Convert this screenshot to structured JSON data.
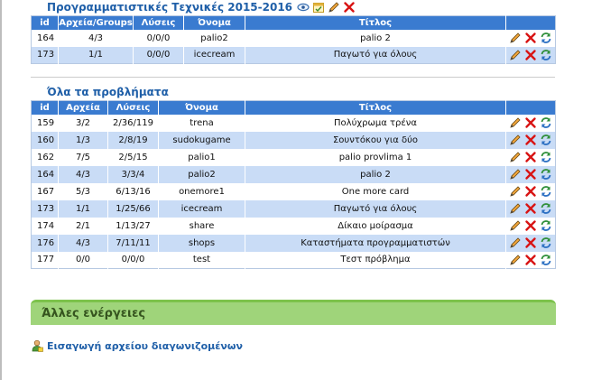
{
  "contest": {
    "title": "Προγραμματιστικές Τεχνικές 2015-2016",
    "columns": [
      "id",
      "Αρχεία/Groups",
      "Λύσεις",
      "Όνομα",
      "Τίτλος",
      ""
    ],
    "rows": [
      {
        "id": "164",
        "files": "4/3",
        "solutions": "0/0/0",
        "name": "palio2",
        "title": "palio 2"
      },
      {
        "id": "173",
        "files": "1/1",
        "solutions": "0/0/0",
        "name": "icecream",
        "title": "Παγωτό για όλους"
      }
    ]
  },
  "problems": {
    "title": "Όλα τα προβλήματα",
    "columns": [
      "id",
      "Αρχεία",
      "Λύσεις",
      "Όνομα",
      "Τίτλος",
      ""
    ],
    "rows": [
      {
        "id": "159",
        "files": "3/2",
        "solutions": "2/36/119",
        "name": "trena",
        "title": "Πολύχρωμα τρένα"
      },
      {
        "id": "160",
        "files": "1/3",
        "solutions": "2/8/19",
        "name": "sudokugame",
        "title": "Σουντόκου για δύο"
      },
      {
        "id": "162",
        "files": "7/5",
        "solutions": "2/5/15",
        "name": "palio1",
        "title": "palio provlima 1"
      },
      {
        "id": "164",
        "files": "4/3",
        "solutions": "3/3/4",
        "name": "palio2",
        "title": "palio 2"
      },
      {
        "id": "167",
        "files": "5/3",
        "solutions": "6/13/16",
        "name": "onemore1",
        "title": "One more card"
      },
      {
        "id": "173",
        "files": "1/1",
        "solutions": "1/25/66",
        "name": "icecream",
        "title": "Παγωτό για όλους"
      },
      {
        "id": "174",
        "files": "2/1",
        "solutions": "1/13/27",
        "name": "share",
        "title": "Δίκαιο μοίρασμα"
      },
      {
        "id": "176",
        "files": "4/3",
        "solutions": "7/11/11",
        "name": "shops",
        "title": "Καταστήματα προγραμματιστών"
      },
      {
        "id": "177",
        "files": "0/0",
        "solutions": "0/0/0",
        "name": "test",
        "title": "Τεστ πρόβλημα"
      }
    ]
  },
  "other_actions": {
    "heading": "Άλλες ενέργειες",
    "import_label": "Εισαγωγή αρχείου διαγωνιζομένων"
  },
  "colors": {
    "header_blue": "#3a7bd0",
    "row_alt": "#c9dcf6",
    "link_blue": "#1f5fa8",
    "panel_green": "#9fd47a"
  },
  "icons": {
    "contest_header": [
      "eye-icon",
      "calendar-icon",
      "pencil-icon",
      "delete-icon"
    ],
    "row_actions": [
      "pencil-icon",
      "delete-icon",
      "refresh-icon"
    ],
    "import": "user-import-icon"
  }
}
